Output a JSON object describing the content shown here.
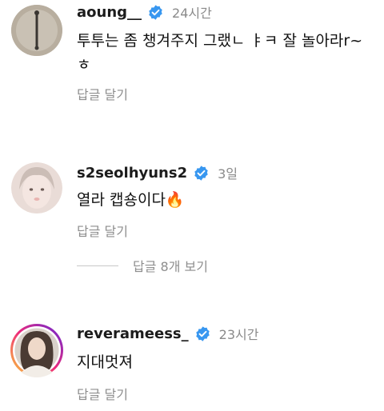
{
  "comments": [
    {
      "username": "aoung__",
      "time": "24시간",
      "text": "투투는 좀 챙겨주지 그랬ㄴ ㅑㅋ 잘 놀아라r~ ㅎ",
      "reply": "답글 달기"
    },
    {
      "username": "s2seolhyuns2",
      "time": "3일",
      "text": "열라 캡숑이다",
      "emoji": "🔥",
      "reply": "답글 달기",
      "view_replies": "답글 8개 보기"
    },
    {
      "username": "reverameess_",
      "time": "23시간",
      "text": "지대멋져",
      "reply": "답글 달기"
    }
  ],
  "colors": {
    "verified": "#3897f0",
    "story_ring_start": "#f9ce34",
    "story_ring_mid": "#ee2a7b",
    "story_ring_end": "#6228d7",
    "muted_text": "#8e8e8e"
  }
}
